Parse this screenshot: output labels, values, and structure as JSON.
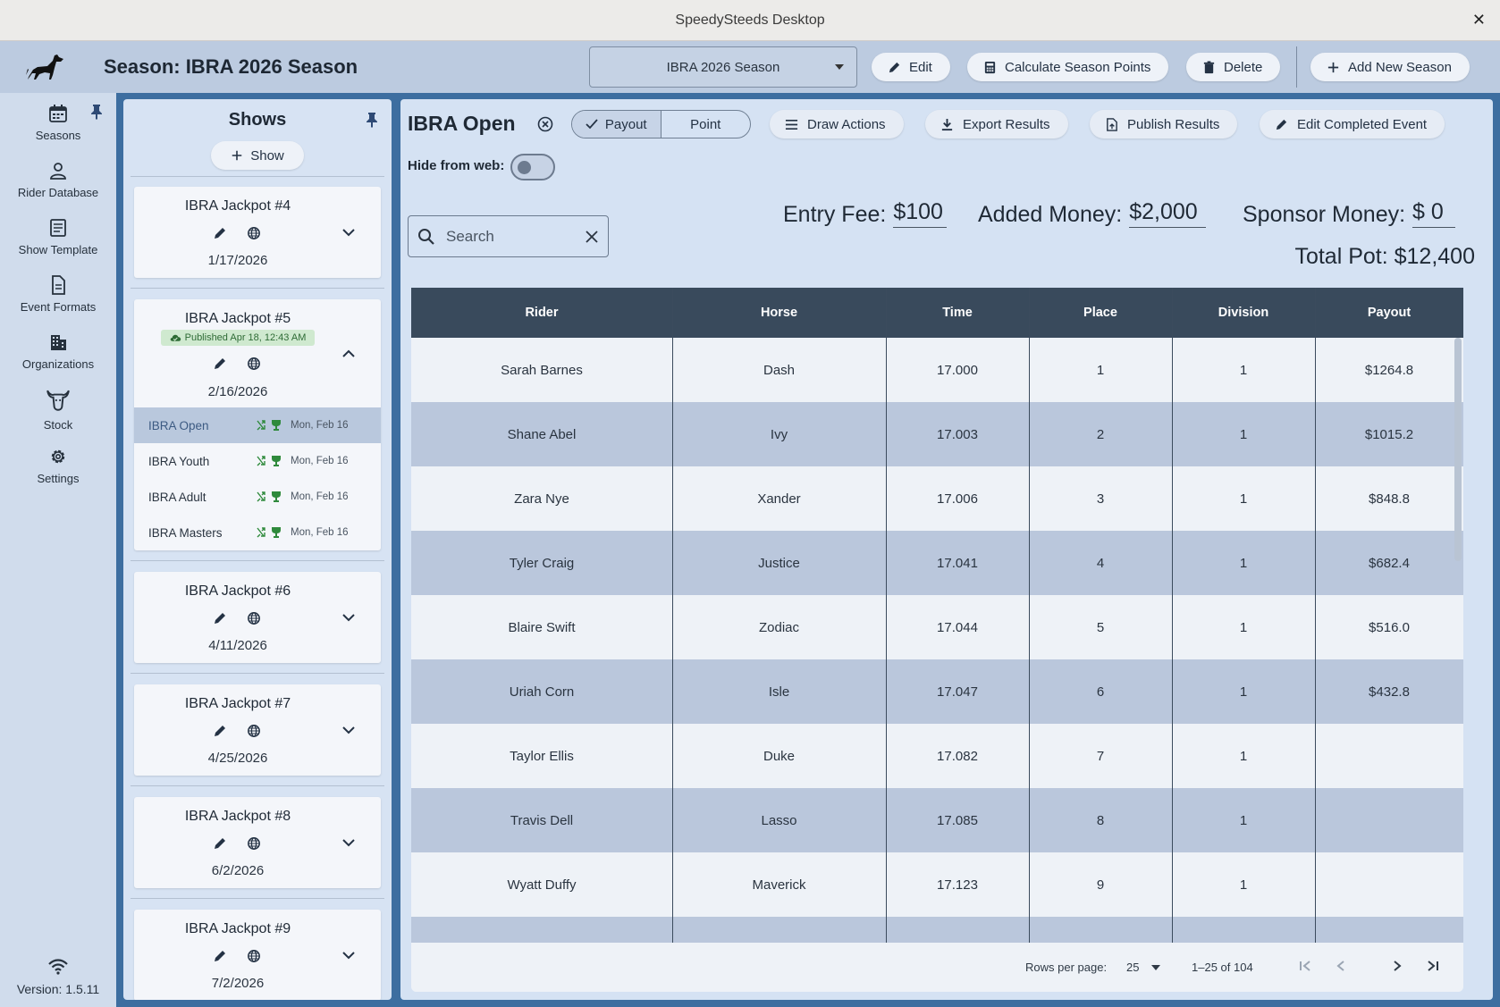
{
  "window": {
    "title": "SpeedySteeds Desktop",
    "close_glyph": "✕"
  },
  "header": {
    "season_title": "Season: IBRA 2026 Season",
    "season_select_value": "IBRA 2026 Season",
    "buttons": {
      "edit": "Edit",
      "calculate": "Calculate Season Points",
      "delete": "Delete",
      "add_new": "Add New Season"
    }
  },
  "rail": {
    "items": [
      {
        "label": "Seasons",
        "icon": "calendar-icon"
      },
      {
        "label": "Rider Database",
        "icon": "person-icon"
      },
      {
        "label": "Show Template",
        "icon": "list-document-icon"
      },
      {
        "label": "Event Formats",
        "icon": "document-icon"
      },
      {
        "label": "Organizations",
        "icon": "building-icon"
      },
      {
        "label": "Stock",
        "icon": "bull-head-icon"
      },
      {
        "label": "Settings",
        "icon": "gear-icon"
      }
    ],
    "version": "Version: 1.5.11"
  },
  "shows": {
    "title": "Shows",
    "add_label": "Show",
    "cards": [
      {
        "name": "IBRA Jackpot #4",
        "date": "1/17/2026"
      },
      {
        "name": "IBRA Jackpot #5",
        "date": "2/16/2026",
        "badge": "Published Apr 18, 12:43 AM",
        "events": [
          {
            "name": "IBRA Open",
            "date": "Mon, Feb 16"
          },
          {
            "name": "IBRA Youth",
            "date": "Mon, Feb 16"
          },
          {
            "name": "IBRA Adult",
            "date": "Mon, Feb 16"
          },
          {
            "name": "IBRA Masters",
            "date": "Mon, Feb 16"
          }
        ]
      },
      {
        "name": "IBRA Jackpot #6",
        "date": "4/11/2026"
      },
      {
        "name": "IBRA Jackpot #7",
        "date": "4/25/2026"
      },
      {
        "name": "IBRA Jackpot #8",
        "date": "6/2/2026"
      },
      {
        "name": "IBRA Jackpot #9",
        "date": "7/2/2026"
      }
    ]
  },
  "event": {
    "title": "IBRA Open",
    "segment_payout": "Payout",
    "segment_point": "Point",
    "actions": {
      "draw": "Draw Actions",
      "export": "Export Results",
      "publish": "Publish Results",
      "edit_completed": "Edit Completed Event"
    },
    "hide_from_web_label": "Hide from web:",
    "hide_from_web": false,
    "search_placeholder": "Search",
    "entry_fee_label": "Entry Fee:",
    "entry_fee": "$100",
    "added_money_label": "Added Money:",
    "added_money": "$2,000",
    "sponsor_money_label": "Sponsor Money:",
    "sponsor_money": "$ 0",
    "total_pot": "Total Pot: $12,400"
  },
  "table": {
    "columns": [
      "Rider",
      "Horse",
      "Time",
      "Place",
      "Division",
      "Payout"
    ],
    "rows": [
      [
        "Sarah Barnes",
        "Dash",
        "17.000",
        "1",
        "1",
        "$1264.8"
      ],
      [
        "Shane Abel",
        "Ivy",
        "17.003",
        "2",
        "1",
        "$1015.2"
      ],
      [
        "Zara Nye",
        "Xander",
        "17.006",
        "3",
        "1",
        "$848.8"
      ],
      [
        "Tyler Craig",
        "Justice",
        "17.041",
        "4",
        "1",
        "$682.4"
      ],
      [
        "Blaire Swift",
        "Zodiac",
        "17.044",
        "5",
        "1",
        "$516.0"
      ],
      [
        "Uriah Corn",
        "Isle",
        "17.047",
        "6",
        "1",
        "$432.8"
      ],
      [
        "Taylor Ellis",
        "Duke",
        "17.082",
        "7",
        "1",
        ""
      ],
      [
        "Travis Dell",
        "Lasso",
        "17.085",
        "8",
        "1",
        ""
      ],
      [
        "Wyatt Duffy",
        "Maverick",
        "17.123",
        "9",
        "1",
        ""
      ],
      [
        "",
        "",
        "",
        "",
        "",
        ""
      ]
    ],
    "rows_per_page_label": "Rows per page:",
    "rows_per_page": "25",
    "range": "1–25 of 104"
  },
  "colors": {
    "header_bg": "#bccbe0",
    "table_header": "#394a5c",
    "row_alt": "#bac7dc",
    "published_green": "#2e6b35",
    "shuffle_green": "#2f8a3c"
  }
}
